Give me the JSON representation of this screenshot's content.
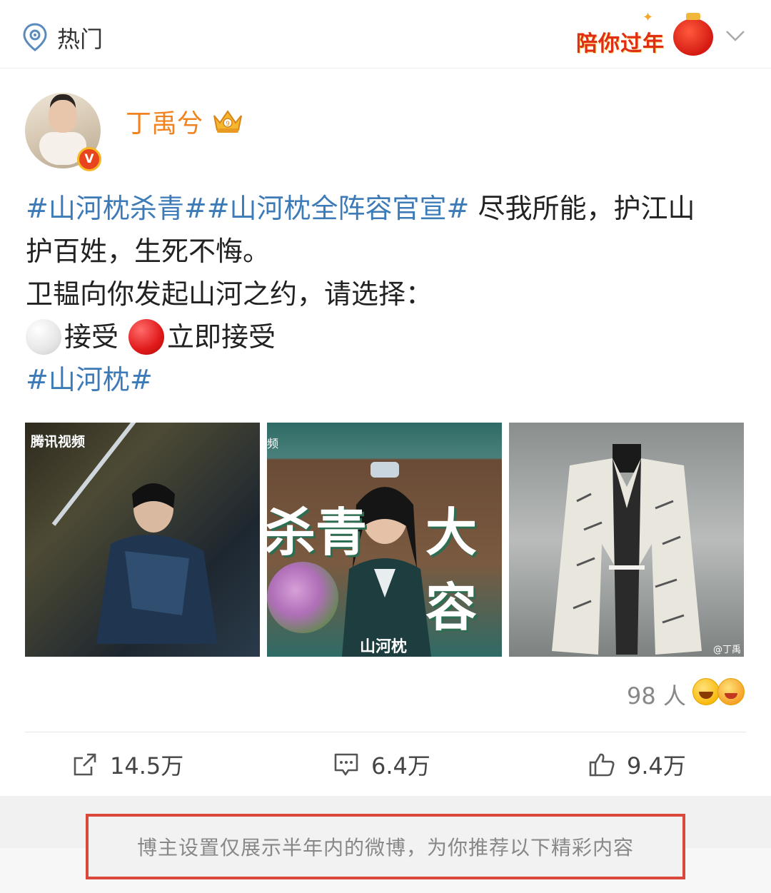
{
  "header": {
    "hot_label": "热门",
    "festival_badge": "陪你过年",
    "icons": {
      "hot": "location-pin-icon",
      "dropdown": "chevron-down-icon"
    }
  },
  "post": {
    "author": "丁禹兮",
    "verified_mark": "V",
    "text": {
      "topic1": "#山河枕杀青#",
      "topic2": "#山河枕全阵容官宣#",
      "line1_rest": " 尽我所能，护江山",
      "line2": "护百姓，生死不悔。",
      "line3": "卫韫向你发起山河之约，请选择：",
      "option1": "接受",
      "option2": "立即接受",
      "topic3": "#山河枕#"
    },
    "images": [
      {
        "watermark": "腾讯视频"
      },
      {
        "corner_text": "频",
        "overlay_left": "杀青",
        "overlay_right": "大容",
        "logo": "山河枕"
      },
      {
        "watermark": "@丁禹"
      }
    ],
    "reactions": {
      "count_label": "98 人",
      "icons": [
        "grinning-emoji-icon",
        "laughing-emoji-icon"
      ]
    },
    "actions": {
      "repost": "14.5万",
      "comment": "6.4万",
      "like": "9.4万"
    }
  },
  "footer": {
    "notice": "博主设置仅展示半年内的微博，为你推荐以下精彩内容"
  },
  "colors": {
    "topic": "#3d7bb8",
    "username": "#f08320",
    "notice_border": "#d9483b",
    "festival": "#e02d16"
  }
}
